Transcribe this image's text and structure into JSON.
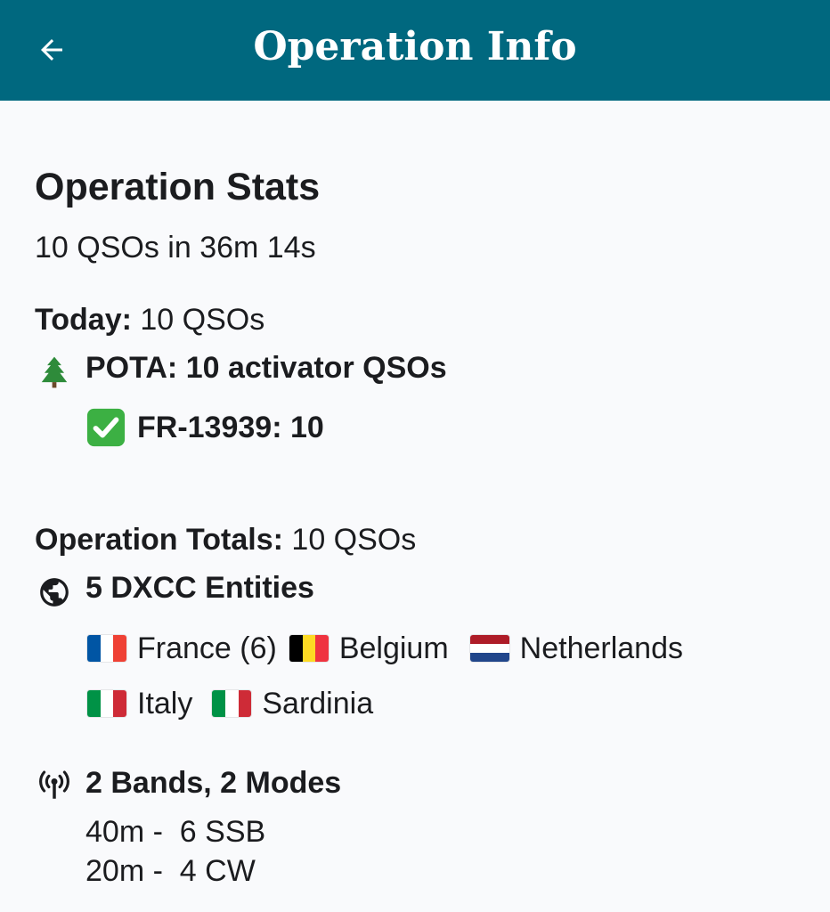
{
  "header": {
    "title": "Operation Info",
    "back_icon": "arrow-back-icon"
  },
  "stats": {
    "heading": "Operation Stats",
    "summary": "10 QSOs in 36m 14s",
    "today_label": "Today:",
    "today_value": "10 QSOs",
    "pota_icon": "tree-icon",
    "pota_text": "POTA: 10 activator QSOs",
    "park_check_icon": "check-mark-icon",
    "park_text": "FR-13939: 10"
  },
  "totals": {
    "label": "Operation Totals:",
    "value": "10 QSOs",
    "dxcc_icon": "globe-icon",
    "dxcc_title": "5 DXCC Entities",
    "entities": [
      {
        "name": "France (6)",
        "flag": "fr"
      },
      {
        "name": "Belgium",
        "flag": "be"
      },
      {
        "name": "Netherlands",
        "flag": "nl"
      },
      {
        "name": "Italy",
        "flag": "it"
      },
      {
        "name": "Sardinia",
        "flag": "it"
      }
    ],
    "bands_icon": "antenna-icon",
    "bands_title": "2 Bands, 2 Modes",
    "bands": [
      "40m -  6 SSB",
      "20m -  4 CW"
    ]
  },
  "colors": {
    "appbar": "#00687f",
    "background": "#f9fafc",
    "text": "#1b1c1f"
  }
}
